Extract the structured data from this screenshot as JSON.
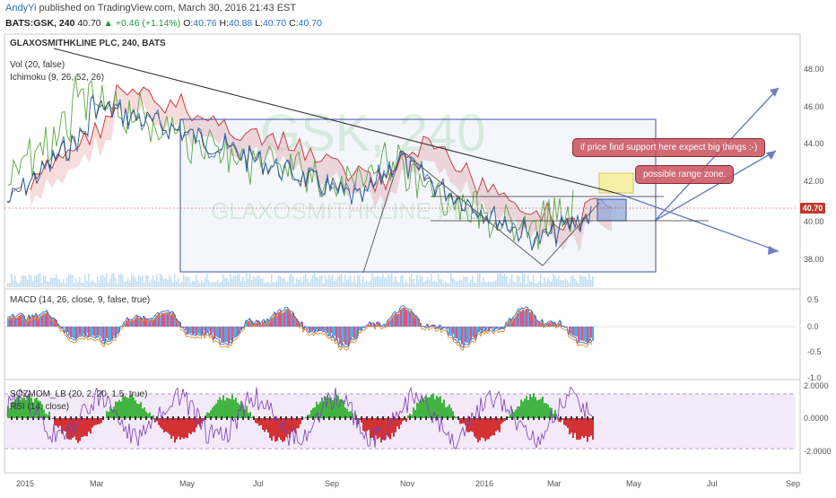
{
  "header": {
    "user": "AndyYi",
    "published": "published on TradingView.com, March 30, 2016 21:43 EST",
    "symbol": "BATS:GSK, 240",
    "last": "40.70",
    "change": "+0.46 (+1.14%)",
    "open_label": "O:",
    "open": "40.76",
    "high_label": "H:",
    "high": "40.88",
    "low_label": "L:",
    "low": "40.70",
    "close_label": "C:",
    "close": "40.70"
  },
  "legends": {
    "title": "GLAXOSMITHKLINE PLC, 240, BATS",
    "vol": "Vol (20, false)",
    "ichimoku": "Ichimoku (9, 26, 52, 26)",
    "macd": "MACD (14, 26, close, 9, false, true)",
    "sqzmom": "SQZMOM_LB (20, 2, 20, 1.5, true)",
    "rsi": "RSI (14, close)"
  },
  "watermark": {
    "ticker": "GSK, 240",
    "name": "GLAXOSMITHKLINE PLC"
  },
  "price_axis": [
    "48.00",
    "46.00",
    "44.00",
    "42.00",
    "40.00",
    "38.00"
  ],
  "price_tag": "40.70",
  "macd_axis": [
    "0.5",
    "0.0",
    "-0.5",
    "-1.0"
  ],
  "sqz_axis": [
    "2.0000",
    "0.0000",
    "-2.0000"
  ],
  "time_axis": [
    "2015",
    "Mar",
    "May",
    "Jul",
    "Sep",
    "Nov",
    "2016",
    "Mar",
    "May",
    "Jul",
    "Sep"
  ],
  "annotations": {
    "note1": "if price find support here expect big things :-)",
    "note2": "possible range zone."
  },
  "colors": {
    "accent": "#2a6ebb",
    "up": "#1a9a3b",
    "down": "#c0392b",
    "cloud_red": "#f2c4c4",
    "macd_pos": "#3a9ad9",
    "macd_neg": "#e0336a",
    "sqz_pos": "#22aa22",
    "sqz_neg": "#cc1111",
    "rsi_band": "#efe0f7"
  }
}
